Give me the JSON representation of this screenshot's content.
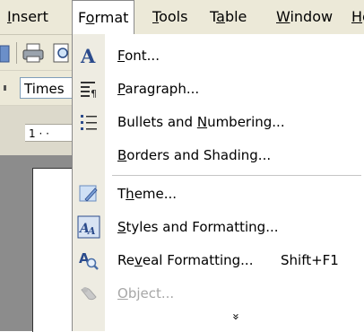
{
  "menubar": {
    "items": [
      {
        "label": "Insert",
        "mnemonic_index": 0
      },
      {
        "label": "Format",
        "mnemonic_index": 1
      },
      {
        "label": "Tools",
        "mnemonic_index": 0
      },
      {
        "label": "Table",
        "mnemonic_index": 1
      },
      {
        "label": "Window",
        "mnemonic_index": 0
      },
      {
        "label": "He",
        "mnemonic_index": 0
      }
    ],
    "open_menu": "Format"
  },
  "toolbar": {
    "font_name": "Times"
  },
  "ruler": {
    "text": "1 · ·"
  },
  "format_menu": {
    "items": [
      {
        "label": "Font...",
        "mnemonic_index": 0,
        "icon": "font-a-icon",
        "shortcut": ""
      },
      {
        "label": "Paragraph...",
        "mnemonic_index": 0,
        "icon": "paragraph-icon",
        "shortcut": ""
      },
      {
        "label": "Bullets and Numbering...",
        "mnemonic_index": 12,
        "icon": "bullets-icon",
        "shortcut": ""
      },
      {
        "label": "Borders and Shading...",
        "mnemonic_index": 0,
        "icon": "",
        "shortcut": ""
      },
      {
        "label": "Theme...",
        "mnemonic_index": 1,
        "icon": "theme-icon",
        "shortcut": ""
      },
      {
        "label": "Styles and Formatting...",
        "mnemonic_index": 0,
        "icon": "styles-icon",
        "shortcut": ""
      },
      {
        "label": "Reveal Formatting...",
        "mnemonic_index": 2,
        "icon": "reveal-formatting-icon",
        "shortcut": "Shift+F1"
      },
      {
        "label": "Object...",
        "mnemonic_index": 0,
        "icon": "object-icon",
        "shortcut": "",
        "disabled": true
      }
    ],
    "expand_glyph": "»"
  },
  "colors": {
    "menubar_bg": "#ece9d8",
    "menu_gutter": "#eeece2",
    "disabled_text": "#a7a7a7"
  }
}
